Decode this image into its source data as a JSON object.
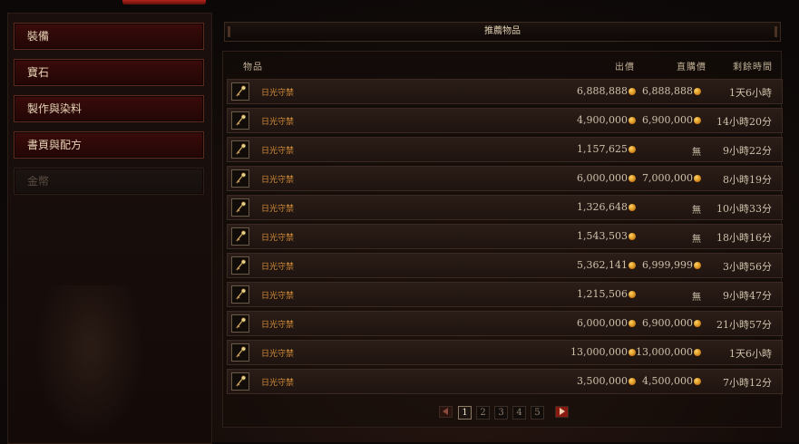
{
  "sidebar": {
    "categories": [
      {
        "label": "裝備",
        "enabled": true
      },
      {
        "label": "寶石",
        "enabled": true
      },
      {
        "label": "製作與染料",
        "enabled": true
      },
      {
        "label": "書頁與配方",
        "enabled": true
      },
      {
        "label": "金幣",
        "enabled": false
      }
    ]
  },
  "header": {
    "title": "推薦物品"
  },
  "columns": {
    "item": "物品",
    "bid": "出價",
    "buyout": "直購價",
    "time_left": "剩餘時間"
  },
  "listings": [
    {
      "name": "日光守禁",
      "bid": "6,888,888",
      "buyout": "6,888,888",
      "time_left": "1天6小時"
    },
    {
      "name": "日光守禁",
      "bid": "4,900,000",
      "buyout": "6,900,000",
      "time_left": "14小時20分"
    },
    {
      "name": "日光守禁",
      "bid": "1,157,625",
      "buyout": "無",
      "time_left": "9小時22分"
    },
    {
      "name": "日光守禁",
      "bid": "6,000,000",
      "buyout": "7,000,000",
      "time_left": "8小時19分"
    },
    {
      "name": "日光守禁",
      "bid": "1,326,648",
      "buyout": "無",
      "time_left": "10小時33分"
    },
    {
      "name": "日光守禁",
      "bid": "1,543,503",
      "buyout": "無",
      "time_left": "18小時16分"
    },
    {
      "name": "日光守禁",
      "bid": "5,362,141",
      "buyout": "6,999,999",
      "time_left": "3小時56分"
    },
    {
      "name": "日光守禁",
      "bid": "1,215,506",
      "buyout": "無",
      "time_left": "9小時47分"
    },
    {
      "name": "日光守禁",
      "bid": "6,000,000",
      "buyout": "6,900,000",
      "time_left": "21小時57分"
    },
    {
      "name": "日光守禁",
      "bid": "13,000,000",
      "buyout": "13,000,000",
      "time_left": "1天6小時"
    },
    {
      "name": "日光守禁",
      "bid": "3,500,000",
      "buyout": "4,500,000",
      "time_left": "7小時12分"
    }
  ],
  "pagination": {
    "pages": [
      "1",
      "2",
      "3",
      "4",
      "5"
    ],
    "current": "1"
  },
  "icons": {
    "item": "scepter-icon",
    "currency": "gold-coin-icon",
    "prev": "prev-page-icon",
    "next": "next-page-icon"
  },
  "colors": {
    "accent": "#d08a37",
    "gold": "#e3a027",
    "nav_active": "#3a0c0a",
    "next_arrow": "#8a1a10"
  }
}
